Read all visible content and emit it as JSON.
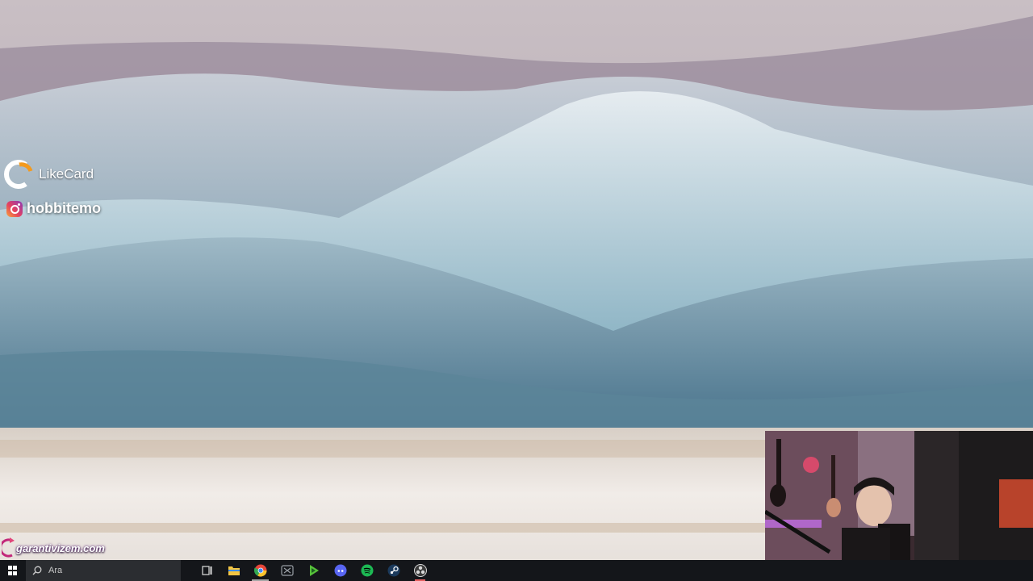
{
  "overlay": {
    "likecard_text": "LikeCard",
    "instagram_handle": "hobbitemo",
    "garanti_text": "garantivizem.com"
  },
  "taskbar": {
    "search_placeholder": "Ara",
    "apps": [
      {
        "name": "task-view",
        "icon": "task-view-icon"
      },
      {
        "name": "file-explorer",
        "icon": "folder-icon",
        "color": "#f4c542"
      },
      {
        "name": "chrome",
        "icon": "chrome-icon",
        "color": "#e8463a"
      },
      {
        "name": "xbox",
        "icon": "xbox-icon",
        "color": "#9aa0a6"
      },
      {
        "name": "media-player",
        "icon": "play-icon",
        "color": "#57c23a"
      },
      {
        "name": "discord",
        "icon": "discord-icon",
        "color": "#5865f2"
      },
      {
        "name": "spotify",
        "icon": "spotify-icon",
        "color": "#1db954"
      },
      {
        "name": "steam",
        "icon": "steam-icon",
        "color": "#2a6fb0"
      },
      {
        "name": "obs",
        "icon": "obs-icon",
        "color": "#d8d8d8"
      }
    ]
  },
  "colors": {
    "taskbar_bg": "#14161a",
    "search_bg": "#2b2d31",
    "likecard_orange": "#f39a1e"
  }
}
